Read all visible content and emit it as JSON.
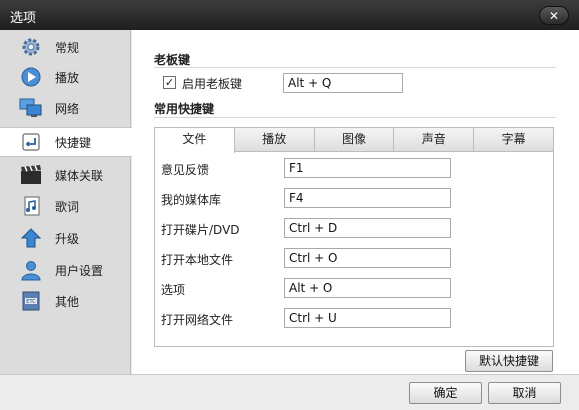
{
  "window": {
    "title": "选项",
    "close_label": "✕"
  },
  "sidebar": {
    "items": [
      {
        "label": "常规",
        "icon": "gear-icon"
      },
      {
        "label": "播放",
        "icon": "play-icon"
      },
      {
        "label": "网络",
        "icon": "network-icon"
      },
      {
        "label": "快捷键",
        "icon": "shortcut-key-icon",
        "active": true
      },
      {
        "label": "媒体关联",
        "icon": "film-icon"
      },
      {
        "label": "歌词",
        "icon": "lyrics-icon"
      },
      {
        "label": "升级",
        "icon": "upgrade-arrow-icon"
      },
      {
        "label": "用户设置",
        "icon": "user-icon"
      },
      {
        "label": "其他",
        "icon": "etc-icon"
      }
    ]
  },
  "boss_key": {
    "section_title": "老板键",
    "checkbox_label": "启用老板键",
    "checked": true,
    "value": "Alt + Q"
  },
  "common": {
    "section_title": "常用快捷键",
    "tabs": [
      "文件",
      "播放",
      "图像",
      "声音",
      "字幕"
    ],
    "active_tab": "文件",
    "rows": [
      {
        "label": "意见反馈",
        "value": "F1"
      },
      {
        "label": "我的媒体库",
        "value": "F4"
      },
      {
        "label": "打开碟片/DVD",
        "value": "Ctrl + D"
      },
      {
        "label": "打开本地文件",
        "value": "Ctrl + O"
      },
      {
        "label": "选项",
        "value": "Alt + O"
      },
      {
        "label": "打开网络文件",
        "value": "Ctrl + U"
      }
    ],
    "default_button": "默认快捷键"
  },
  "footer": {
    "ok": "确定",
    "cancel": "取消"
  }
}
